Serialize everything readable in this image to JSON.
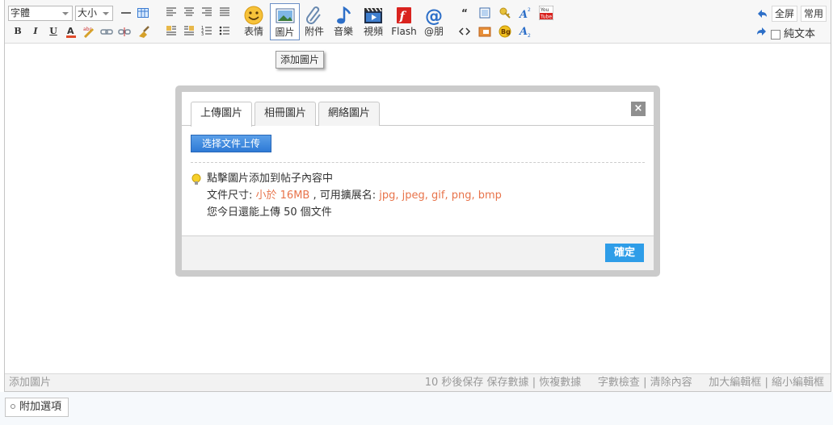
{
  "toolbar": {
    "font_select": "字體",
    "size_select": "大小",
    "big_buttons": [
      {
        "label": "表情",
        "icon": "smiley-icon"
      },
      {
        "label": "圖片",
        "icon": "image-icon"
      },
      {
        "label": "附件",
        "icon": "paperclip-icon"
      },
      {
        "label": "音樂",
        "icon": "music-note-icon"
      },
      {
        "label": "視頻",
        "icon": "video-icon"
      },
      {
        "label": "Flash",
        "icon": "flash-icon"
      },
      {
        "label": "@朋",
        "icon": "at-icon"
      }
    ],
    "fullscreen_label": "全屏",
    "common_label": "常用",
    "plain_text_label": "純文本"
  },
  "tooltip": "添加圖片",
  "dialog": {
    "tabs": [
      "上傳圖片",
      "相冊圖片",
      "網絡圖片"
    ],
    "active_tab": 0,
    "close_symbol": "×",
    "upload_button": "选择文件上传",
    "info_line1": "點擊圖片添加到帖子內容中",
    "size_prefix": "文件尺寸: ",
    "size_value": "小於 16MB",
    "ext_prefix": " , 可用擴展名: ",
    "ext_value": "jpg, jpeg, gif, png, bmp",
    "quota_text": "您今日還能上傳 50 個文件",
    "ok_button": "確定"
  },
  "statusbar": {
    "left": "添加圖片",
    "autosave": "10 秒後保存",
    "save_data": "保存數據",
    "restore_data": "恢複數據",
    "word_check": "字數檢查",
    "clear_content": "清除內容",
    "enlarge": "加大編輯框",
    "shrink": "縮小編輯框",
    "sep": "|"
  },
  "attach_button": "附加選項",
  "colors": {
    "accent": "#2e9de8",
    "highlight": "#e8734a"
  }
}
